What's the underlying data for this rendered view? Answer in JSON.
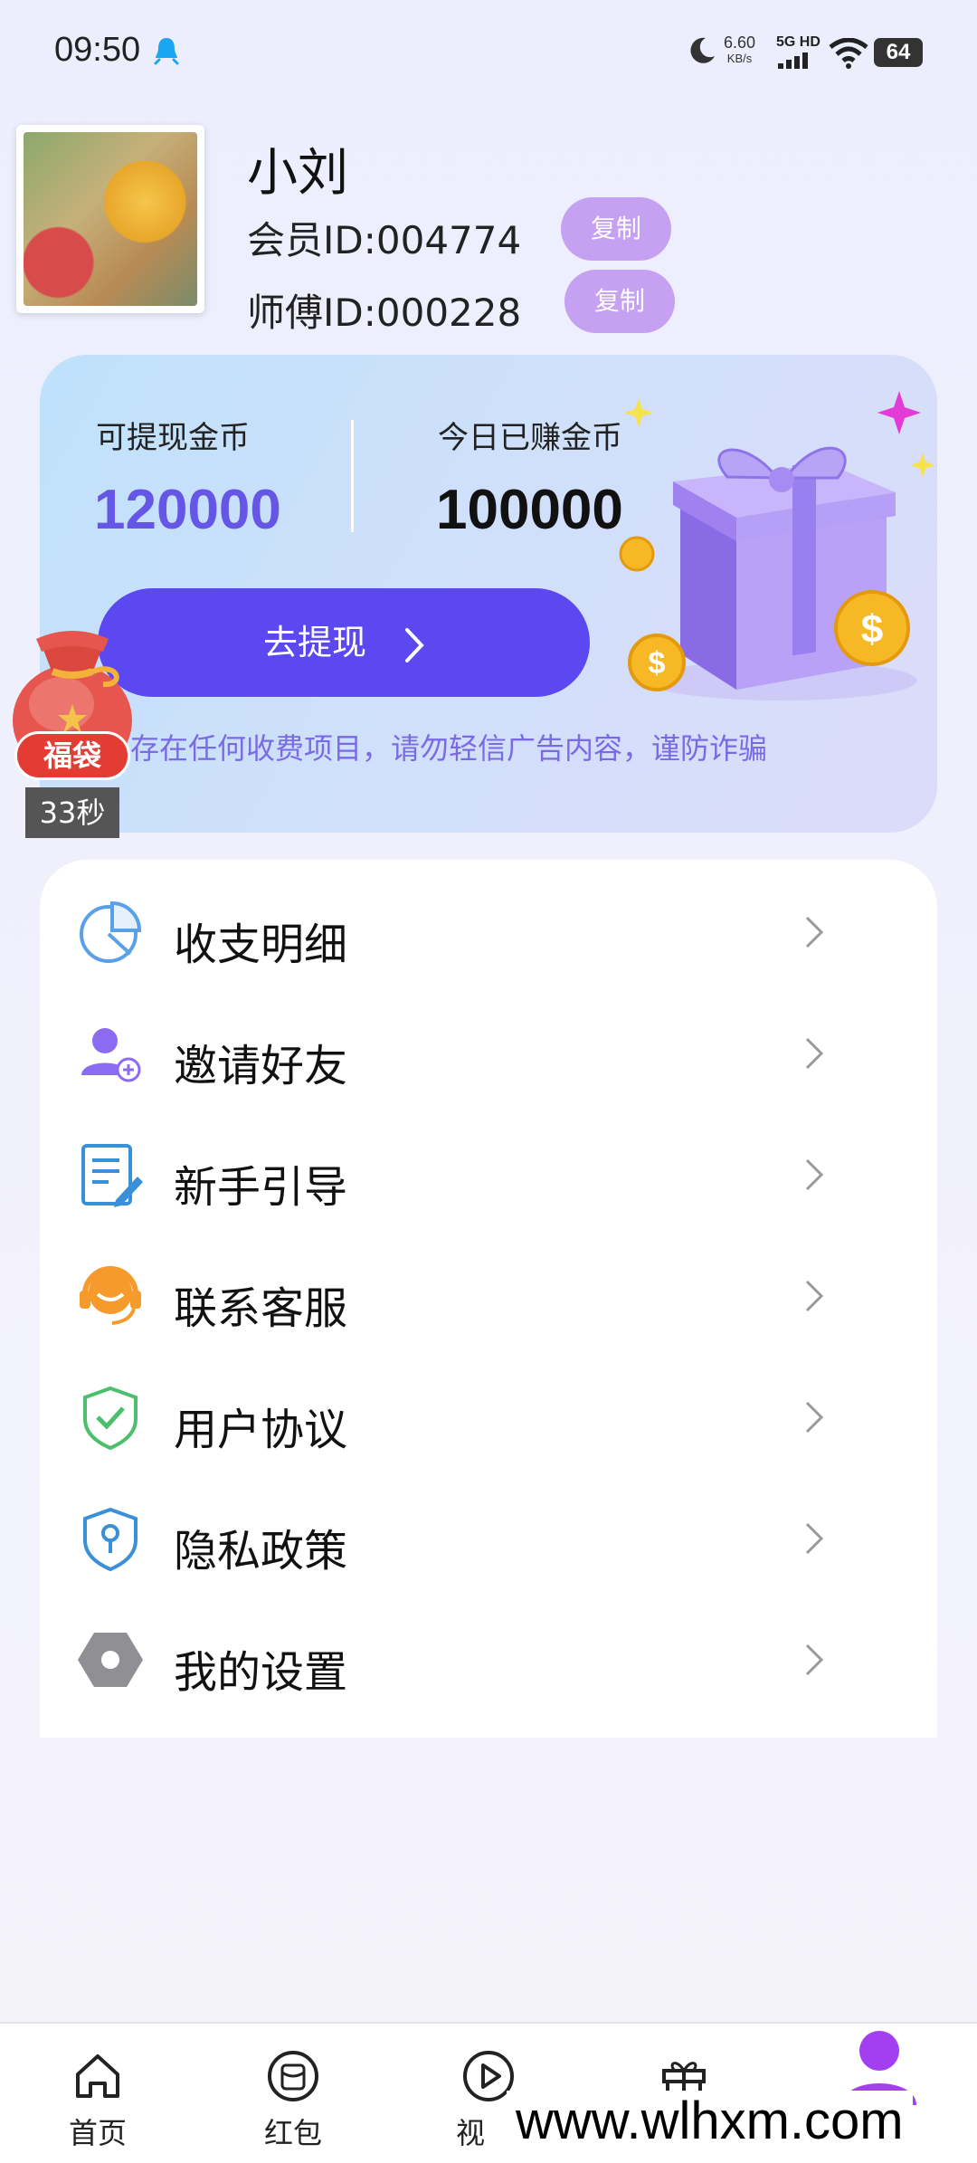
{
  "status_bar": {
    "time": "09:50",
    "speed_value": "6.60",
    "speed_unit": "KB/s",
    "network": "5G HD",
    "battery": "64"
  },
  "profile": {
    "name": "小刘",
    "member_id_label": "会员ID:",
    "member_id": "004774",
    "master_id_label": "师傅ID:",
    "master_id": "000228",
    "copy_label": "复制"
  },
  "wallet": {
    "withdrawable_label": "可提现金币",
    "withdrawable_value": "120000",
    "today_label": "今日已赚金币",
    "today_value": "100000",
    "withdraw_button": "去提现",
    "notice": "存在任何收费项目，请勿轻信广告内容，谨防诈骗"
  },
  "lucky_bag": {
    "label": "福袋",
    "countdown": "33秒"
  },
  "menu": {
    "items": [
      {
        "label": "收支明细",
        "icon": "pie-chart-icon"
      },
      {
        "label": "邀请好友",
        "icon": "add-user-icon"
      },
      {
        "label": "新手引导",
        "icon": "guide-doc-icon"
      },
      {
        "label": "联系客服",
        "icon": "headset-icon"
      },
      {
        "label": "用户协议",
        "icon": "shield-check-icon"
      },
      {
        "label": "隐私政策",
        "icon": "shield-location-icon"
      },
      {
        "label": "我的设置",
        "icon": "hexagon-settings-icon"
      }
    ]
  },
  "bottom_nav": {
    "items": [
      {
        "label": "首页",
        "icon": "home-icon"
      },
      {
        "label": "红包",
        "icon": "red-packet-icon"
      },
      {
        "label": "视",
        "icon": "play-icon"
      },
      {
        "label": "",
        "icon": "gift-icon"
      },
      {
        "label": "",
        "icon": "user-icon"
      }
    ]
  },
  "watermark": "www.wlhxm.com",
  "colors": {
    "accent": "#5c48f0",
    "copy_button": "#c6a1f2",
    "value_purple": "#6656e6",
    "active_nav": "#a23ff0"
  }
}
